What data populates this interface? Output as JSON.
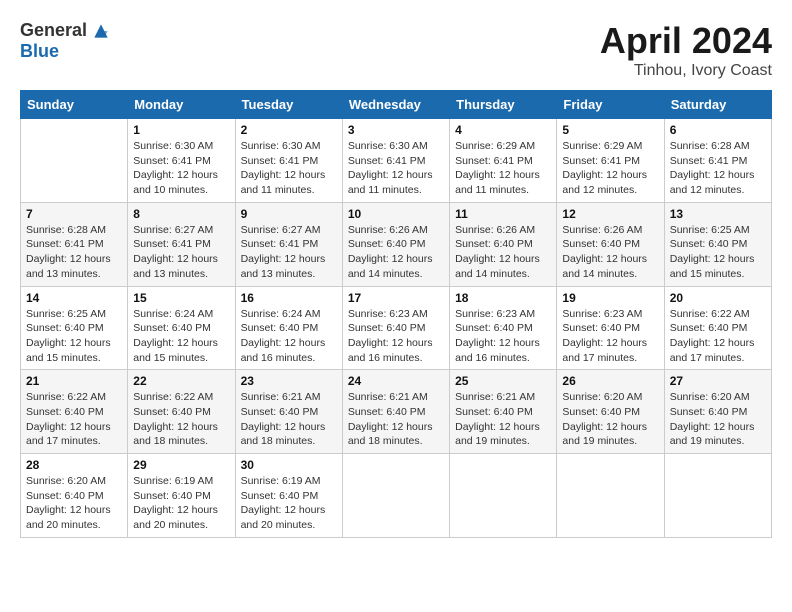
{
  "header": {
    "logo_general": "General",
    "logo_blue": "Blue",
    "title": "April 2024",
    "subtitle": "Tinhou, Ivory Coast"
  },
  "calendar": {
    "days_of_week": [
      "Sunday",
      "Monday",
      "Tuesday",
      "Wednesday",
      "Thursday",
      "Friday",
      "Saturday"
    ],
    "weeks": [
      [
        {
          "day": "",
          "info": ""
        },
        {
          "day": "1",
          "info": "Sunrise: 6:30 AM\nSunset: 6:41 PM\nDaylight: 12 hours\nand 10 minutes."
        },
        {
          "day": "2",
          "info": "Sunrise: 6:30 AM\nSunset: 6:41 PM\nDaylight: 12 hours\nand 11 minutes."
        },
        {
          "day": "3",
          "info": "Sunrise: 6:30 AM\nSunset: 6:41 PM\nDaylight: 12 hours\nand 11 minutes."
        },
        {
          "day": "4",
          "info": "Sunrise: 6:29 AM\nSunset: 6:41 PM\nDaylight: 12 hours\nand 11 minutes."
        },
        {
          "day": "5",
          "info": "Sunrise: 6:29 AM\nSunset: 6:41 PM\nDaylight: 12 hours\nand 12 minutes."
        },
        {
          "day": "6",
          "info": "Sunrise: 6:28 AM\nSunset: 6:41 PM\nDaylight: 12 hours\nand 12 minutes."
        }
      ],
      [
        {
          "day": "7",
          "info": "Sunrise: 6:28 AM\nSunset: 6:41 PM\nDaylight: 12 hours\nand 13 minutes."
        },
        {
          "day": "8",
          "info": "Sunrise: 6:27 AM\nSunset: 6:41 PM\nDaylight: 12 hours\nand 13 minutes."
        },
        {
          "day": "9",
          "info": "Sunrise: 6:27 AM\nSunset: 6:41 PM\nDaylight: 12 hours\nand 13 minutes."
        },
        {
          "day": "10",
          "info": "Sunrise: 6:26 AM\nSunset: 6:40 PM\nDaylight: 12 hours\nand 14 minutes."
        },
        {
          "day": "11",
          "info": "Sunrise: 6:26 AM\nSunset: 6:40 PM\nDaylight: 12 hours\nand 14 minutes."
        },
        {
          "day": "12",
          "info": "Sunrise: 6:26 AM\nSunset: 6:40 PM\nDaylight: 12 hours\nand 14 minutes."
        },
        {
          "day": "13",
          "info": "Sunrise: 6:25 AM\nSunset: 6:40 PM\nDaylight: 12 hours\nand 15 minutes."
        }
      ],
      [
        {
          "day": "14",
          "info": "Sunrise: 6:25 AM\nSunset: 6:40 PM\nDaylight: 12 hours\nand 15 minutes."
        },
        {
          "day": "15",
          "info": "Sunrise: 6:24 AM\nSunset: 6:40 PM\nDaylight: 12 hours\nand 15 minutes."
        },
        {
          "day": "16",
          "info": "Sunrise: 6:24 AM\nSunset: 6:40 PM\nDaylight: 12 hours\nand 16 minutes."
        },
        {
          "day": "17",
          "info": "Sunrise: 6:23 AM\nSunset: 6:40 PM\nDaylight: 12 hours\nand 16 minutes."
        },
        {
          "day": "18",
          "info": "Sunrise: 6:23 AM\nSunset: 6:40 PM\nDaylight: 12 hours\nand 16 minutes."
        },
        {
          "day": "19",
          "info": "Sunrise: 6:23 AM\nSunset: 6:40 PM\nDaylight: 12 hours\nand 17 minutes."
        },
        {
          "day": "20",
          "info": "Sunrise: 6:22 AM\nSunset: 6:40 PM\nDaylight: 12 hours\nand 17 minutes."
        }
      ],
      [
        {
          "day": "21",
          "info": "Sunrise: 6:22 AM\nSunset: 6:40 PM\nDaylight: 12 hours\nand 17 minutes."
        },
        {
          "day": "22",
          "info": "Sunrise: 6:22 AM\nSunset: 6:40 PM\nDaylight: 12 hours\nand 18 minutes."
        },
        {
          "day": "23",
          "info": "Sunrise: 6:21 AM\nSunset: 6:40 PM\nDaylight: 12 hours\nand 18 minutes."
        },
        {
          "day": "24",
          "info": "Sunrise: 6:21 AM\nSunset: 6:40 PM\nDaylight: 12 hours\nand 18 minutes."
        },
        {
          "day": "25",
          "info": "Sunrise: 6:21 AM\nSunset: 6:40 PM\nDaylight: 12 hours\nand 19 minutes."
        },
        {
          "day": "26",
          "info": "Sunrise: 6:20 AM\nSunset: 6:40 PM\nDaylight: 12 hours\nand 19 minutes."
        },
        {
          "day": "27",
          "info": "Sunrise: 6:20 AM\nSunset: 6:40 PM\nDaylight: 12 hours\nand 19 minutes."
        }
      ],
      [
        {
          "day": "28",
          "info": "Sunrise: 6:20 AM\nSunset: 6:40 PM\nDaylight: 12 hours\nand 20 minutes."
        },
        {
          "day": "29",
          "info": "Sunrise: 6:19 AM\nSunset: 6:40 PM\nDaylight: 12 hours\nand 20 minutes."
        },
        {
          "day": "30",
          "info": "Sunrise: 6:19 AM\nSunset: 6:40 PM\nDaylight: 12 hours\nand 20 minutes."
        },
        {
          "day": "",
          "info": ""
        },
        {
          "day": "",
          "info": ""
        },
        {
          "day": "",
          "info": ""
        },
        {
          "day": "",
          "info": ""
        }
      ]
    ]
  }
}
